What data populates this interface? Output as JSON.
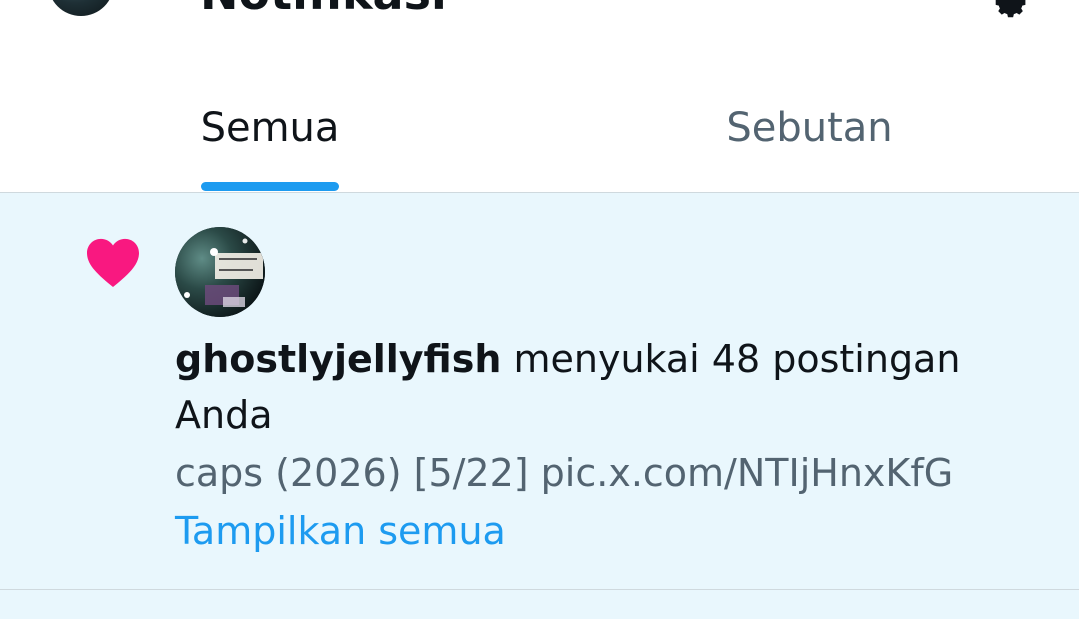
{
  "header": {
    "title": "Notifikasi",
    "settings_icon": "gear-icon"
  },
  "tabs": [
    {
      "label": "Semua",
      "active": true
    },
    {
      "label": "Sebutan",
      "active": false
    }
  ],
  "notification": {
    "icon": "heart-icon",
    "icon_color": "#f91880",
    "actor_name": "ghostlyjellyfish",
    "action_text": " menyukai 48 postingan Anda",
    "preview_text": "caps (2026) [5/22] pic.x.com/NTIjHnxKfG",
    "show_all_label": "Tampilkan semua"
  },
  "colors": {
    "accent": "#1d9bf0",
    "unread_background": "#e9f7fd",
    "secondary_text": "#536471",
    "like": "#f91880"
  }
}
